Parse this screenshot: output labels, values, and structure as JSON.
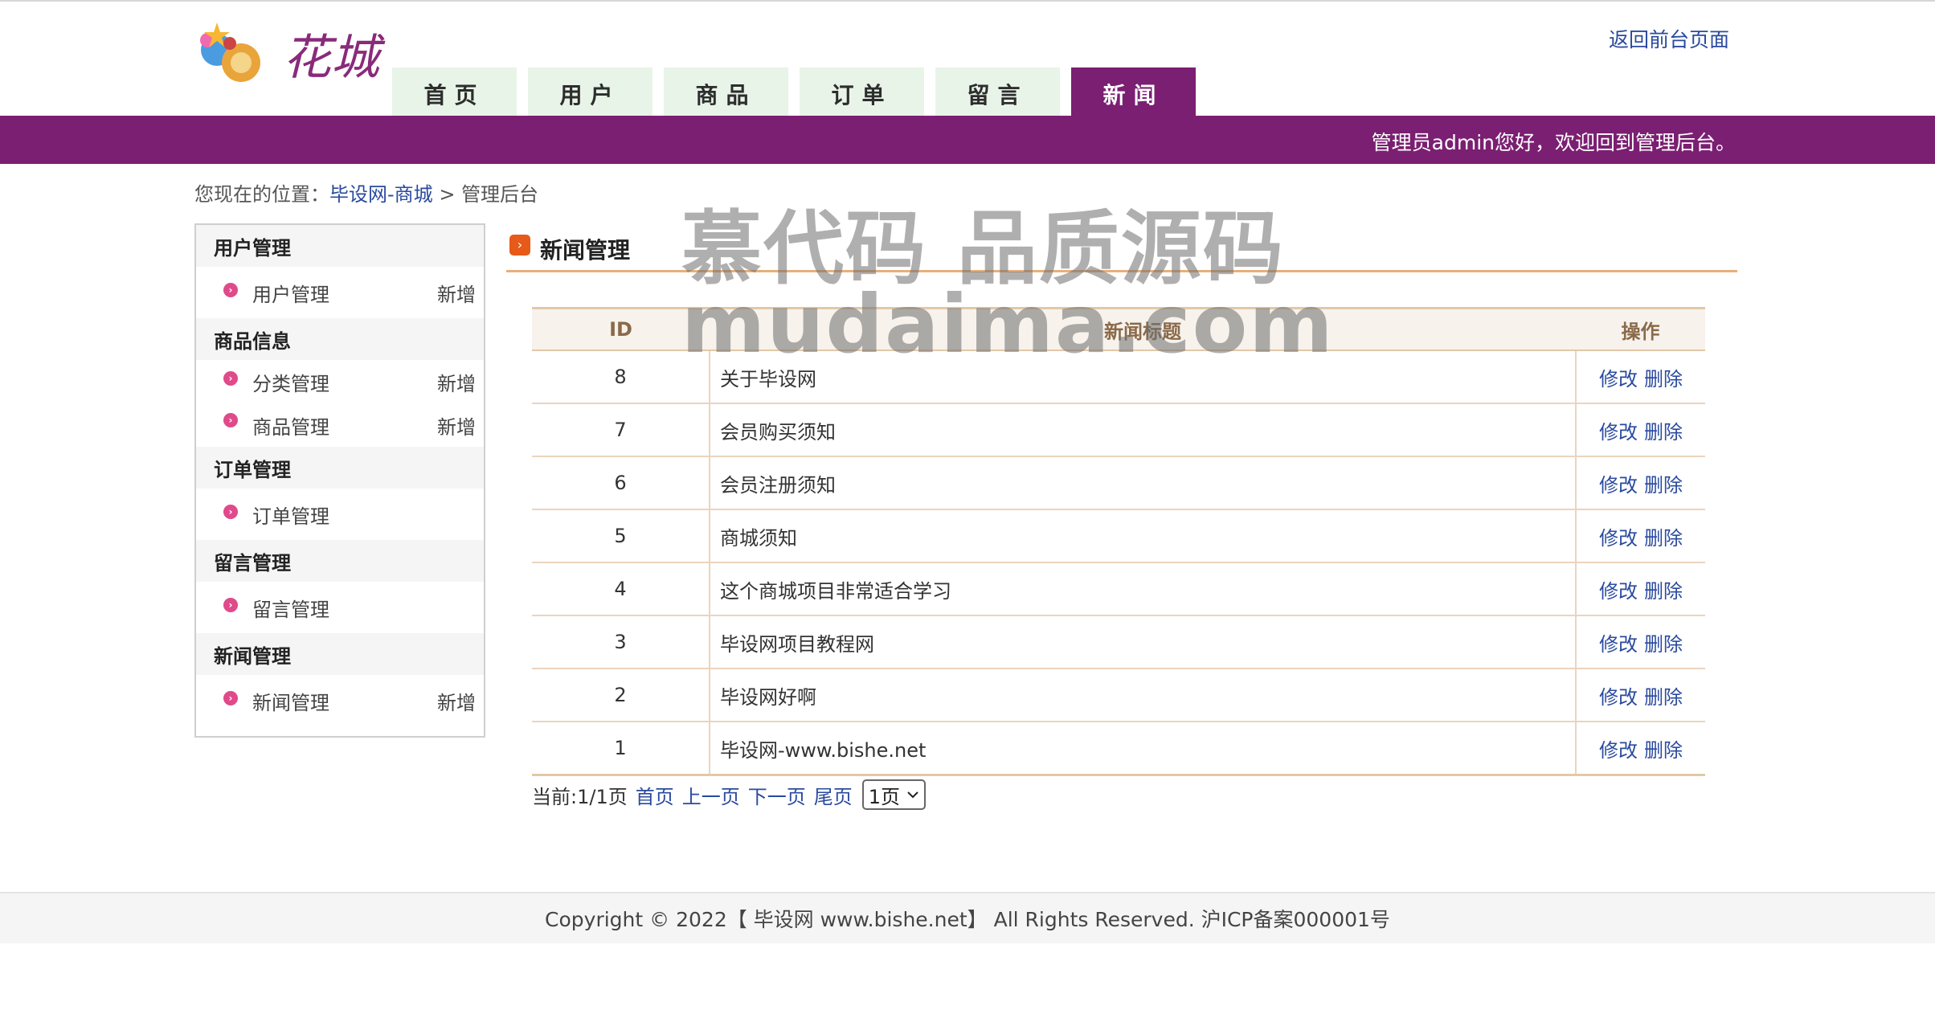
{
  "header": {
    "logo_text": "花城",
    "back_link": "返回前台页面",
    "tabs": [
      {
        "label": "首页"
      },
      {
        "label": "用户"
      },
      {
        "label": "商品"
      },
      {
        "label": "订单"
      },
      {
        "label": "留言"
      },
      {
        "label": "新闻"
      }
    ],
    "active_tab": "新闻",
    "welcome": "管理员admin您好，欢迎回到管理后台。"
  },
  "breadcrumb": {
    "prefix": "您现在的位置：",
    "link": "毕设网-商城",
    "separator": ">",
    "current": "管理后台"
  },
  "sidebar": {
    "groups": [
      {
        "title": "用户管理",
        "items": [
          {
            "label": "用户管理",
            "action": "新增"
          }
        ]
      },
      {
        "title": "商品信息",
        "items": [
          {
            "label": "分类管理",
            "action": "新增"
          },
          {
            "label": "商品管理",
            "action": "新增"
          }
        ]
      },
      {
        "title": "订单管理",
        "items": [
          {
            "label": "订单管理",
            "action": ""
          }
        ]
      },
      {
        "title": "留言管理",
        "items": [
          {
            "label": "留言管理",
            "action": ""
          }
        ]
      },
      {
        "title": "新闻管理",
        "items": [
          {
            "label": "新闻管理",
            "action": "新增"
          }
        ]
      }
    ]
  },
  "main": {
    "title": "新闻管理",
    "columns": [
      "ID",
      "新闻标题",
      "操作"
    ],
    "rows": [
      {
        "id": "8",
        "title": "关于毕设网",
        "edit": "修改",
        "delete": "删除"
      },
      {
        "id": "7",
        "title": "会员购买须知",
        "edit": "修改",
        "delete": "删除"
      },
      {
        "id": "6",
        "title": "会员注册须知",
        "edit": "修改",
        "delete": "删除"
      },
      {
        "id": "5",
        "title": "商城须知",
        "edit": "修改",
        "delete": "删除"
      },
      {
        "id": "4",
        "title": "这个商城项目非常适合学习",
        "edit": "修改",
        "delete": "删除"
      },
      {
        "id": "3",
        "title": "毕设网项目教程网",
        "edit": "修改",
        "delete": "删除"
      },
      {
        "id": "2",
        "title": "毕设网好啊",
        "edit": "修改",
        "delete": "删除"
      },
      {
        "id": "1",
        "title": "毕设网-www.bishe.net",
        "edit": "修改",
        "delete": "删除"
      }
    ],
    "pager": {
      "current": "当前:1/1页",
      "first": "首页",
      "prev": "上一页",
      "next": "下一页",
      "last": "尾页",
      "select_value": "1页"
    }
  },
  "watermark": {
    "line1": "慕代码 品质源码",
    "line2": "mudaima.com"
  },
  "footer": {
    "text": "Copyright © 2022【 毕设网 www.bishe.net】 All Rights Reserved. 沪ICP备案000001号"
  },
  "colors": {
    "brand_purple": "#7b1f72",
    "tab_bg": "#e8f4e8",
    "link_blue": "#2a4a9f",
    "table_border": "#e3c8a8"
  }
}
